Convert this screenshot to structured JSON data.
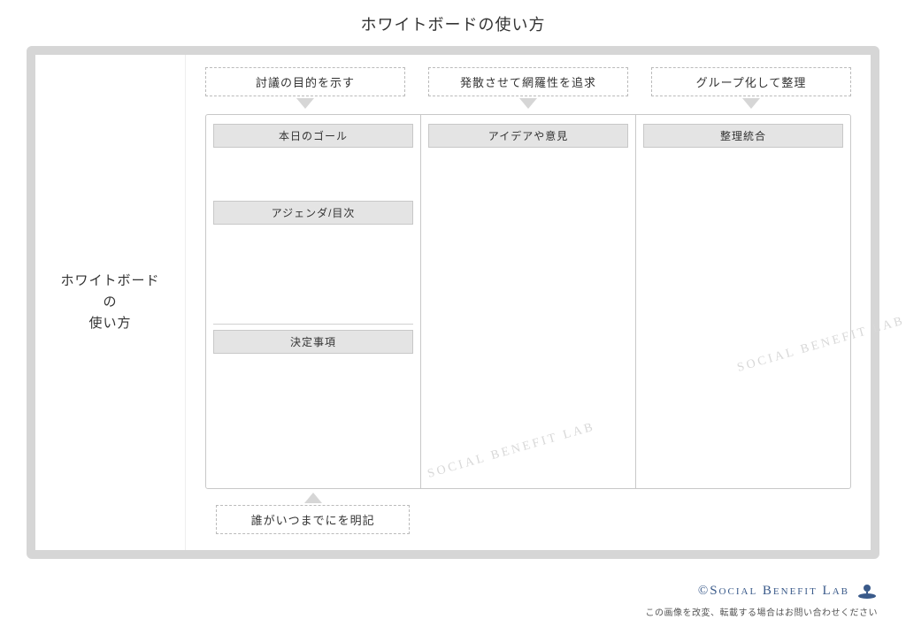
{
  "page_title": "ホワイトボードの使い方",
  "sidebar": {
    "line1": "ホワイトボード",
    "line2": "の",
    "line3": "使い方"
  },
  "top_labels": {
    "col1": "討議の目的を示す",
    "col2": "発散させて網羅性を追求",
    "col3": "グループ化して整理"
  },
  "columns": {
    "col1": {
      "section1": "本日のゴール",
      "section2": "アジェンダ/目次",
      "section3": "決定事項"
    },
    "col2": {
      "section1": "アイデアや意見"
    },
    "col3": {
      "section1": "整理統合"
    }
  },
  "bottom_label": "誰がいつまでにを明記",
  "watermark_text": "SOCIAL BENEFIT LAB",
  "footer": {
    "brand": "©Social Benefit Lab",
    "note": "この画像を改変、転載する場合はお問い合わせください"
  }
}
